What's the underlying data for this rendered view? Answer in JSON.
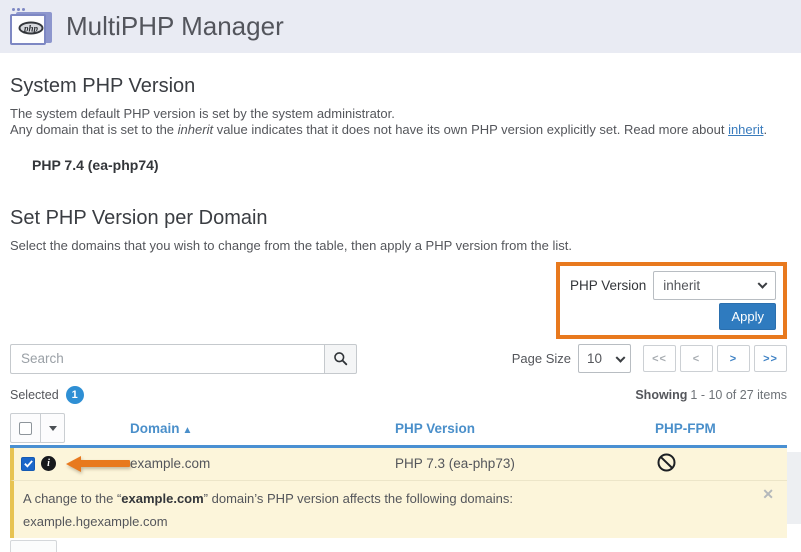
{
  "masthead": {
    "title": "MultiPHP Manager",
    "app_icon": "php-app-icon",
    "php_logo_text": "php"
  },
  "system_section": {
    "heading": "System PHP Version",
    "line1": "The system default PHP version is set by the system administrator.",
    "line2_pre": "Any domain that is set to the ",
    "line2_em": "inherit",
    "line2_mid": " value indicates that it does not have its own PHP version explicitly set. Read more about ",
    "line2_link": "inherit",
    "line2_end": ".",
    "current_version": "PHP 7.4 (ea-php74)"
  },
  "domain_section": {
    "heading": "Set PHP Version per Domain",
    "description": "Select the domains that you wish to change from the table, then apply a PHP version from the list.",
    "apply_panel": {
      "label": "PHP Version",
      "selected_option": "inherit",
      "apply_button": "Apply"
    }
  },
  "toolbar": {
    "search_placeholder": "Search",
    "search_icon": "magnifier",
    "page_size_label": "Page Size",
    "page_size_value": "10",
    "pagination": [
      "<<",
      "<",
      ">",
      ">>"
    ],
    "selected_label": "Selected",
    "selected_count": "1",
    "showing_label": "Showing",
    "showing_range": "1 - 10 of 27 items"
  },
  "table": {
    "columns": [
      "Domain",
      "PHP Version",
      "PHP-FPM"
    ],
    "sort_indicator": "▲",
    "rows": [
      {
        "domain": "example.com",
        "php_version": "PHP 7.3 (ea-php73)",
        "php_fpm": "prohibited-icon",
        "selected": true
      }
    ]
  },
  "notice": {
    "text_pre": "A change to the “",
    "domain": "example.com",
    "text_post": "” domain’s PHP version affects the following domains:",
    "affected_domain": "example.hgexample.com",
    "close_glyph": "✕"
  },
  "icons": {
    "info_glyph": "i"
  },
  "colors": {
    "annotation_orange": "#e8791e",
    "apply_blue": "#2f7bbf",
    "table_header_blue": "#4a8fca",
    "divider_blue": "#4a90d2",
    "selected_row_bg": "#fcf5da",
    "selected_row_border": "#e7c352",
    "badge_blue": "#2e8fd4",
    "masthead_bg": "#e9ebf3"
  }
}
